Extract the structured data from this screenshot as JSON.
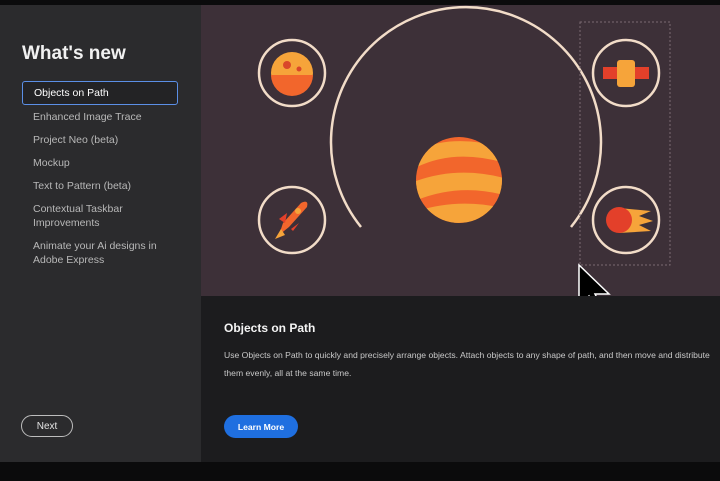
{
  "sidebar": {
    "title": "What's new",
    "items": [
      {
        "label": "Objects on Path",
        "active": true
      },
      {
        "label": "Enhanced Image Trace"
      },
      {
        "label": "Project Neo (beta)"
      },
      {
        "label": "Mockup"
      },
      {
        "label": "Text to Pattern (beta)"
      },
      {
        "label": "Contextual Taskbar Improvements"
      },
      {
        "label": "Animate your Ai designs in Adobe Express"
      }
    ],
    "next_label": "Next"
  },
  "feature": {
    "title": "Objects on Path",
    "description": "Use Objects on Path to quickly and precisely arrange objects. Attach objects to any shape of path, and then move and distribute them evenly, all at the same time.",
    "learn_more_label": "Learn More"
  },
  "hero": {
    "background": "#3d3038",
    "icons": [
      "planet-icon",
      "satellite-icon",
      "rocket-icon",
      "comet-icon",
      "sun-planet-icon",
      "mouse-cursor-icon"
    ]
  },
  "colors": {
    "accent": "#1f6fe0",
    "active_outline": "#5b8fe6",
    "sidebar_bg": "#2b2b2d",
    "orange": "#f2662c",
    "amber": "#f6a43a"
  }
}
